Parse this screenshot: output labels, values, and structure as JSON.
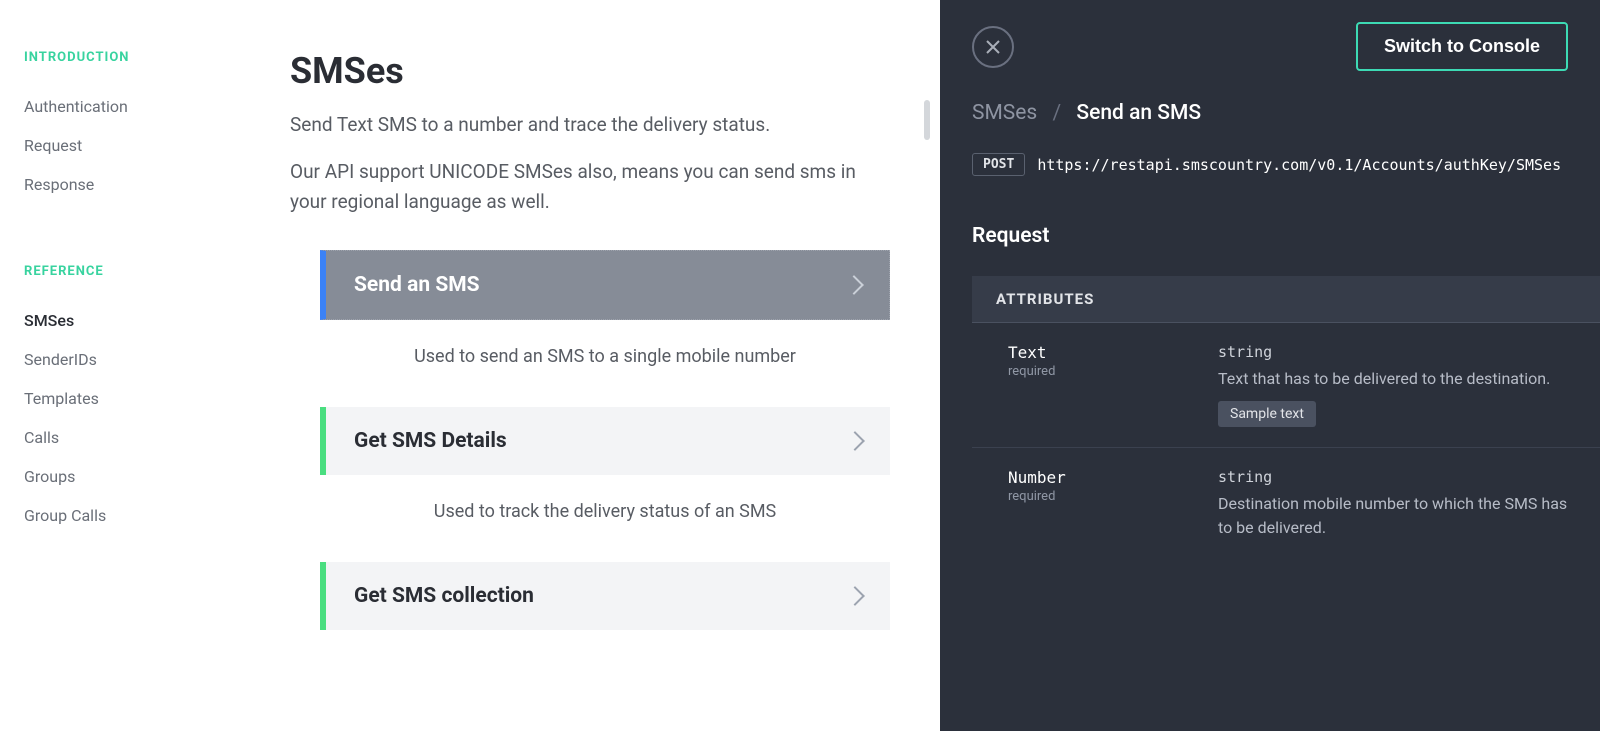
{
  "sidebar": {
    "sec1_label": "INTRODUCTION",
    "sec1_items": [
      "Authentication",
      "Request",
      "Response"
    ],
    "sec2_label": "REFERENCE",
    "sec2_items": [
      "SMSes",
      "SenderIDs",
      "Templates",
      "Calls",
      "Groups",
      "Group Calls"
    ],
    "sec2_active_index": 0
  },
  "main": {
    "title": "SMSes",
    "para1": "Send Text SMS to a number and trace the delivery status.",
    "para2": "Our API support UNICODE SMSes also, means you can send sms in your regional language as well.",
    "items": [
      {
        "title": "Send an SMS",
        "desc": "Used to send an SMS to a single mobile number",
        "active": true
      },
      {
        "title": "Get SMS Details",
        "desc": "Used to track the delivery status of an SMS",
        "active": false
      },
      {
        "title": "Get SMS collection",
        "desc": "",
        "active": false
      }
    ]
  },
  "panel": {
    "console_btn": "Switch to Console",
    "crumb_parent": "SMSes",
    "crumb_current": "Send an SMS",
    "method": "POST",
    "url": "https://restapi.smscountry.com/v0.1/Accounts/authKey/SMSes",
    "request_label": "Request",
    "attr_header": "ATTRIBUTES",
    "attrs": [
      {
        "name": "Text",
        "req": "required",
        "type": "string",
        "desc": "Text that has to be delivered to the destination.",
        "sample": "Sample text"
      },
      {
        "name": "Number",
        "req": "required",
        "type": "string",
        "desc": "Destination mobile number to which the SMS has to be delivered.",
        "sample": ""
      }
    ]
  }
}
